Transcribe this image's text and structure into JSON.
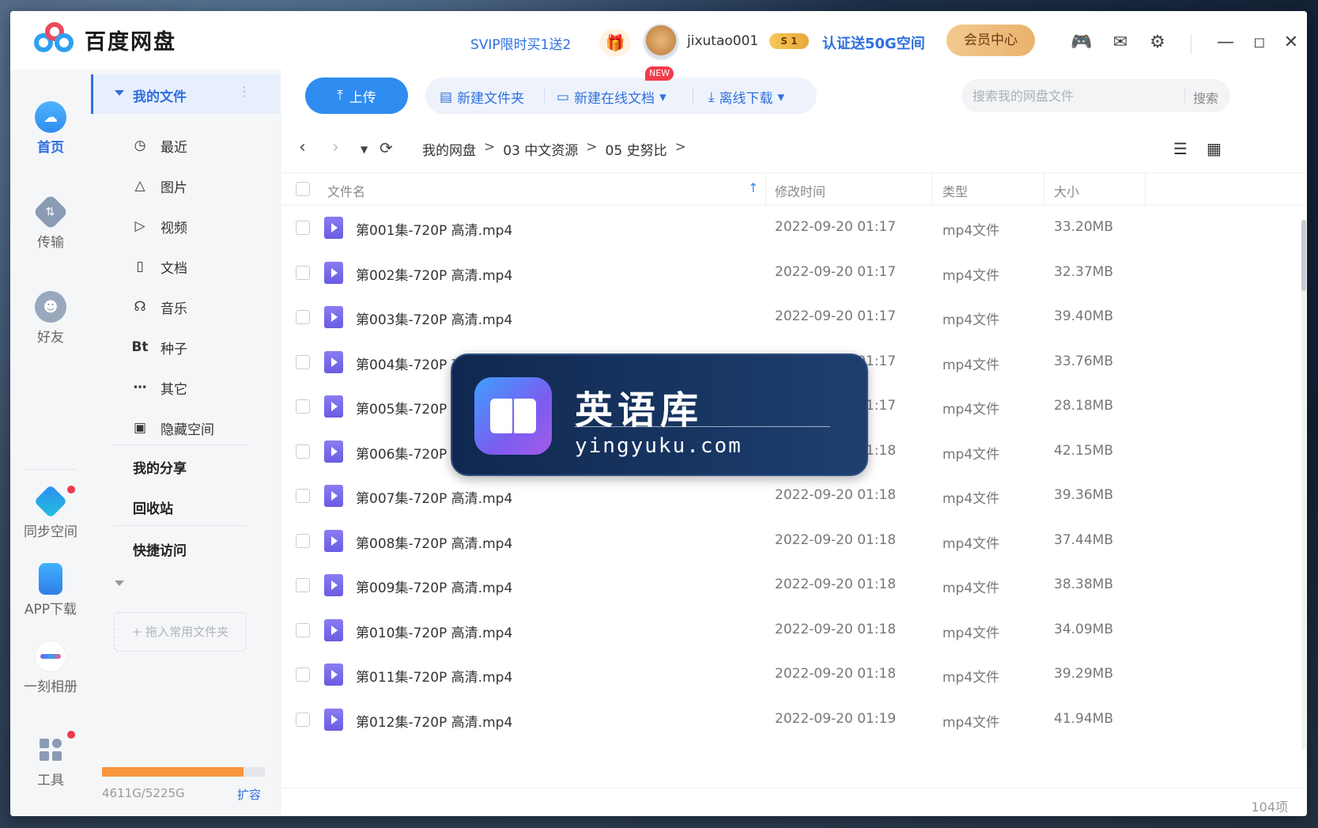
{
  "app": {
    "title": "百度网盘",
    "promo": "SVIP限时买1送2",
    "username": "jixutao001",
    "vip_badge": "S 1",
    "cert_promo": "认证送50G空间",
    "member_center": "会员中心",
    "accent_color": "#2f6fe0"
  },
  "leftnav": [
    {
      "label": "首页",
      "icon": "cloud-icon",
      "active": true
    },
    {
      "label": "传输",
      "icon": "transfer-icon"
    },
    {
      "label": "好友",
      "icon": "friends-icon"
    },
    {
      "label": "同步空间",
      "icon": "sync-icon"
    },
    {
      "label": "APP下载",
      "icon": "phone-icon"
    },
    {
      "label": "一刻相册",
      "icon": "album-icon"
    },
    {
      "label": "工具",
      "icon": "tools-icon"
    }
  ],
  "tree": {
    "my_files": "我的文件",
    "items": [
      {
        "label": "最近",
        "icon": "clock-icon"
      },
      {
        "label": "图片",
        "icon": "image-icon"
      },
      {
        "label": "视频",
        "icon": "play-icon"
      },
      {
        "label": "文档",
        "icon": "document-icon"
      },
      {
        "label": "音乐",
        "icon": "headphone-icon"
      },
      {
        "label": "种子",
        "icon": "bt-icon",
        "glyph": "Bt"
      },
      {
        "label": "其它",
        "icon": "more-icon"
      },
      {
        "label": "隐藏空间",
        "icon": "lock-icon"
      }
    ],
    "my_share": "我的分享",
    "recycle": "回收站",
    "quick_access": "快捷访问",
    "drop_hint": "+ 拖入常用文件夹",
    "storage_text": "4611G/5225G",
    "storage_used_fraction": 0.87,
    "expand": "扩容"
  },
  "toolbar": {
    "upload": "上传",
    "new_folder": "新建文件夹",
    "new_online_doc": "新建在线文档",
    "new_badge": "NEW",
    "offline_download": "离线下载",
    "search_placeholder": "搜索我的网盘文件",
    "search_button": "搜索"
  },
  "breadcrumb": [
    "我的网盘",
    "03 中文资源",
    "05 史努比"
  ],
  "table": {
    "headers": {
      "name": "文件名",
      "modified": "修改时间",
      "type": "类型",
      "size": "大小"
    },
    "rows": [
      {
        "name": "第001集-720P 高清.mp4",
        "modified": "2022-09-20 01:17",
        "type": "mp4文件",
        "size": "33.20MB"
      },
      {
        "name": "第002集-720P 高清.mp4",
        "modified": "2022-09-20 01:17",
        "type": "mp4文件",
        "size": "32.37MB"
      },
      {
        "name": "第003集-720P 高清.mp4",
        "modified": "2022-09-20 01:17",
        "type": "mp4文件",
        "size": "39.40MB"
      },
      {
        "name": "第004集-720P 高清.mp4",
        "modified": "2022-09-20 01:17",
        "type": "mp4文件",
        "size": "33.76MB"
      },
      {
        "name": "第005集-720P 高清.mp4",
        "modified": "2022-09-20 01:17",
        "type": "mp4文件",
        "size": "28.18MB"
      },
      {
        "name": "第006集-720P 高清.mp4",
        "modified": "2022-09-20 01:18",
        "type": "mp4文件",
        "size": "42.15MB"
      },
      {
        "name": "第007集-720P 高清.mp4",
        "modified": "2022-09-20 01:18",
        "type": "mp4文件",
        "size": "39.36MB"
      },
      {
        "name": "第008集-720P 高清.mp4",
        "modified": "2022-09-20 01:18",
        "type": "mp4文件",
        "size": "37.44MB"
      },
      {
        "name": "第009集-720P 高清.mp4",
        "modified": "2022-09-20 01:18",
        "type": "mp4文件",
        "size": "38.38MB"
      },
      {
        "name": "第010集-720P 高清.mp4",
        "modified": "2022-09-20 01:18",
        "type": "mp4文件",
        "size": "34.09MB"
      },
      {
        "name": "第011集-720P 高清.mp4",
        "modified": "2022-09-20 01:18",
        "type": "mp4文件",
        "size": "39.29MB"
      },
      {
        "name": "第012集-720P 高清.mp4",
        "modified": "2022-09-20 01:19",
        "type": "mp4文件",
        "size": "41.94MB"
      }
    ],
    "item_count": "104项"
  },
  "watermark": {
    "title": "英语库",
    "url": "yingyuku.com"
  }
}
